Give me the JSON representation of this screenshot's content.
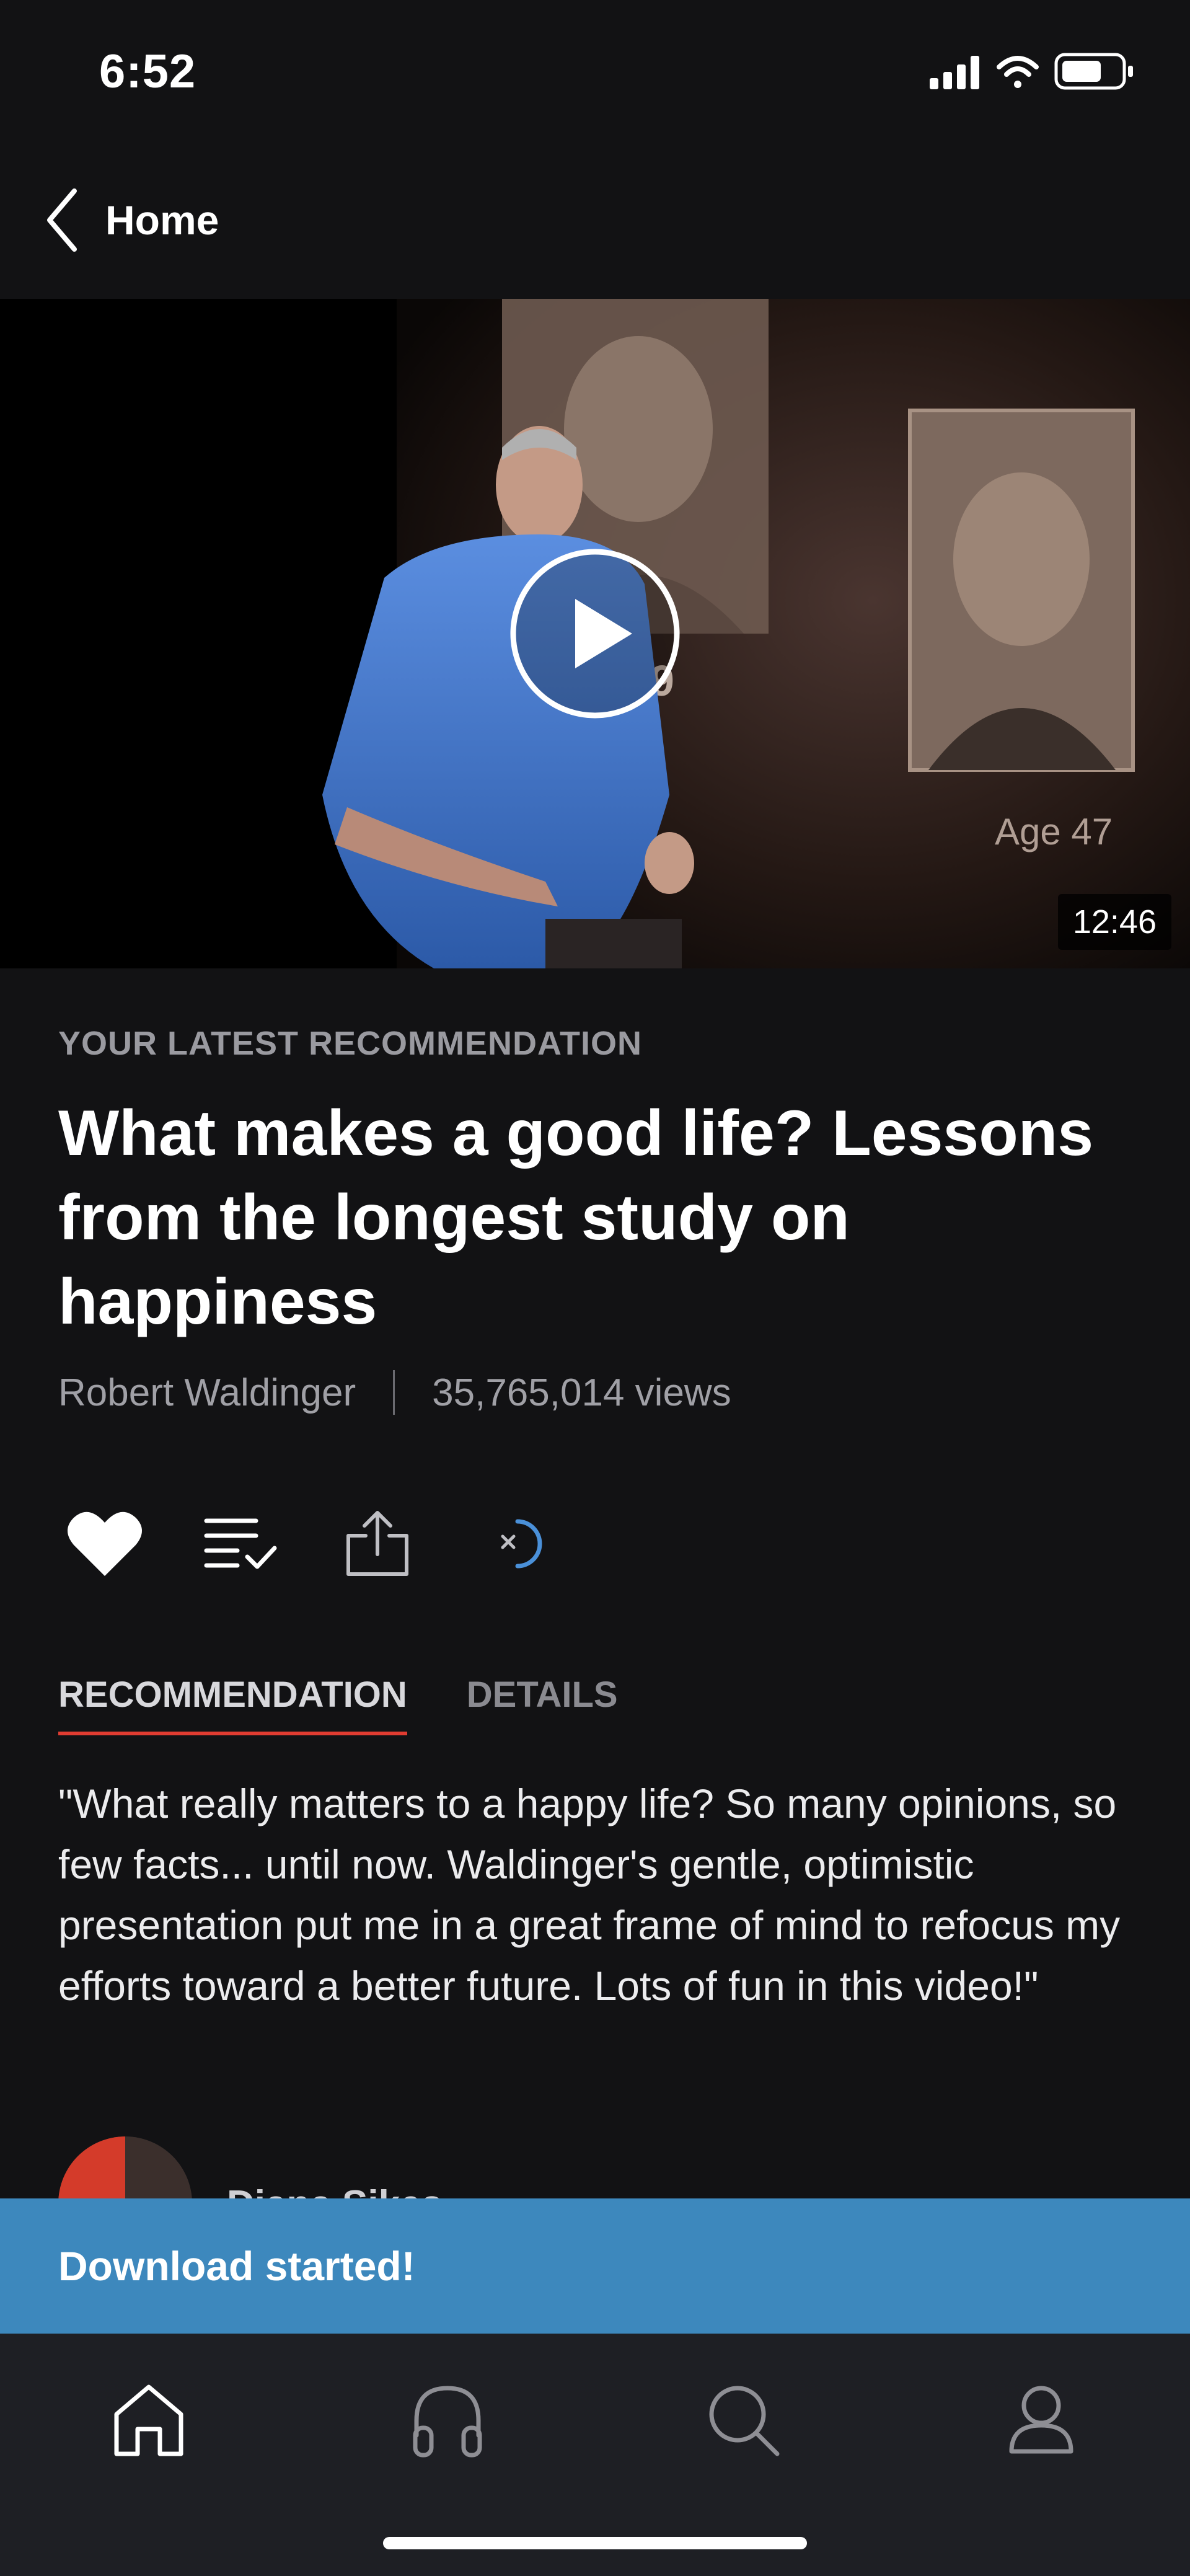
{
  "status_bar": {
    "time": "6:52"
  },
  "nav": {
    "back_label": "Home"
  },
  "video": {
    "duration": "12:46",
    "slide_text_1": "19",
    "slide_text_2": "Age 47"
  },
  "content": {
    "eyebrow": "YOUR LATEST RECOMMENDATION",
    "title": "What makes a good life? Lessons from the longest study on happiness",
    "speaker": "Robert Waldinger",
    "views": "35,765,014 views"
  },
  "tabs": [
    {
      "label": "RECOMMENDATION",
      "active": true
    },
    {
      "label": "DETAILS",
      "active": false
    }
  ],
  "recommendation": {
    "quote": "\"What really matters to a happy life? So many opinions, so few facts... until now. Waldinger's gentle, optimistic presentation put me in a great frame of mind to refocus my efforts toward a better future.  Lots of fun in this video!\"",
    "reviewer_name": "Diana Sikes"
  },
  "toast": {
    "message": "Download started!"
  },
  "tab_bar": {
    "items": [
      {
        "name": "home",
        "icon": "home-icon"
      },
      {
        "name": "podcasts",
        "icon": "headphones-icon"
      },
      {
        "name": "search",
        "icon": "search-icon"
      },
      {
        "name": "profile",
        "icon": "person-icon"
      }
    ]
  },
  "colors": {
    "background": "#121214",
    "accent_red": "#e03c31",
    "toast_blue": "#3d88bd",
    "download_blue": "#4a90d9",
    "tabbar": "#1e1f24"
  }
}
